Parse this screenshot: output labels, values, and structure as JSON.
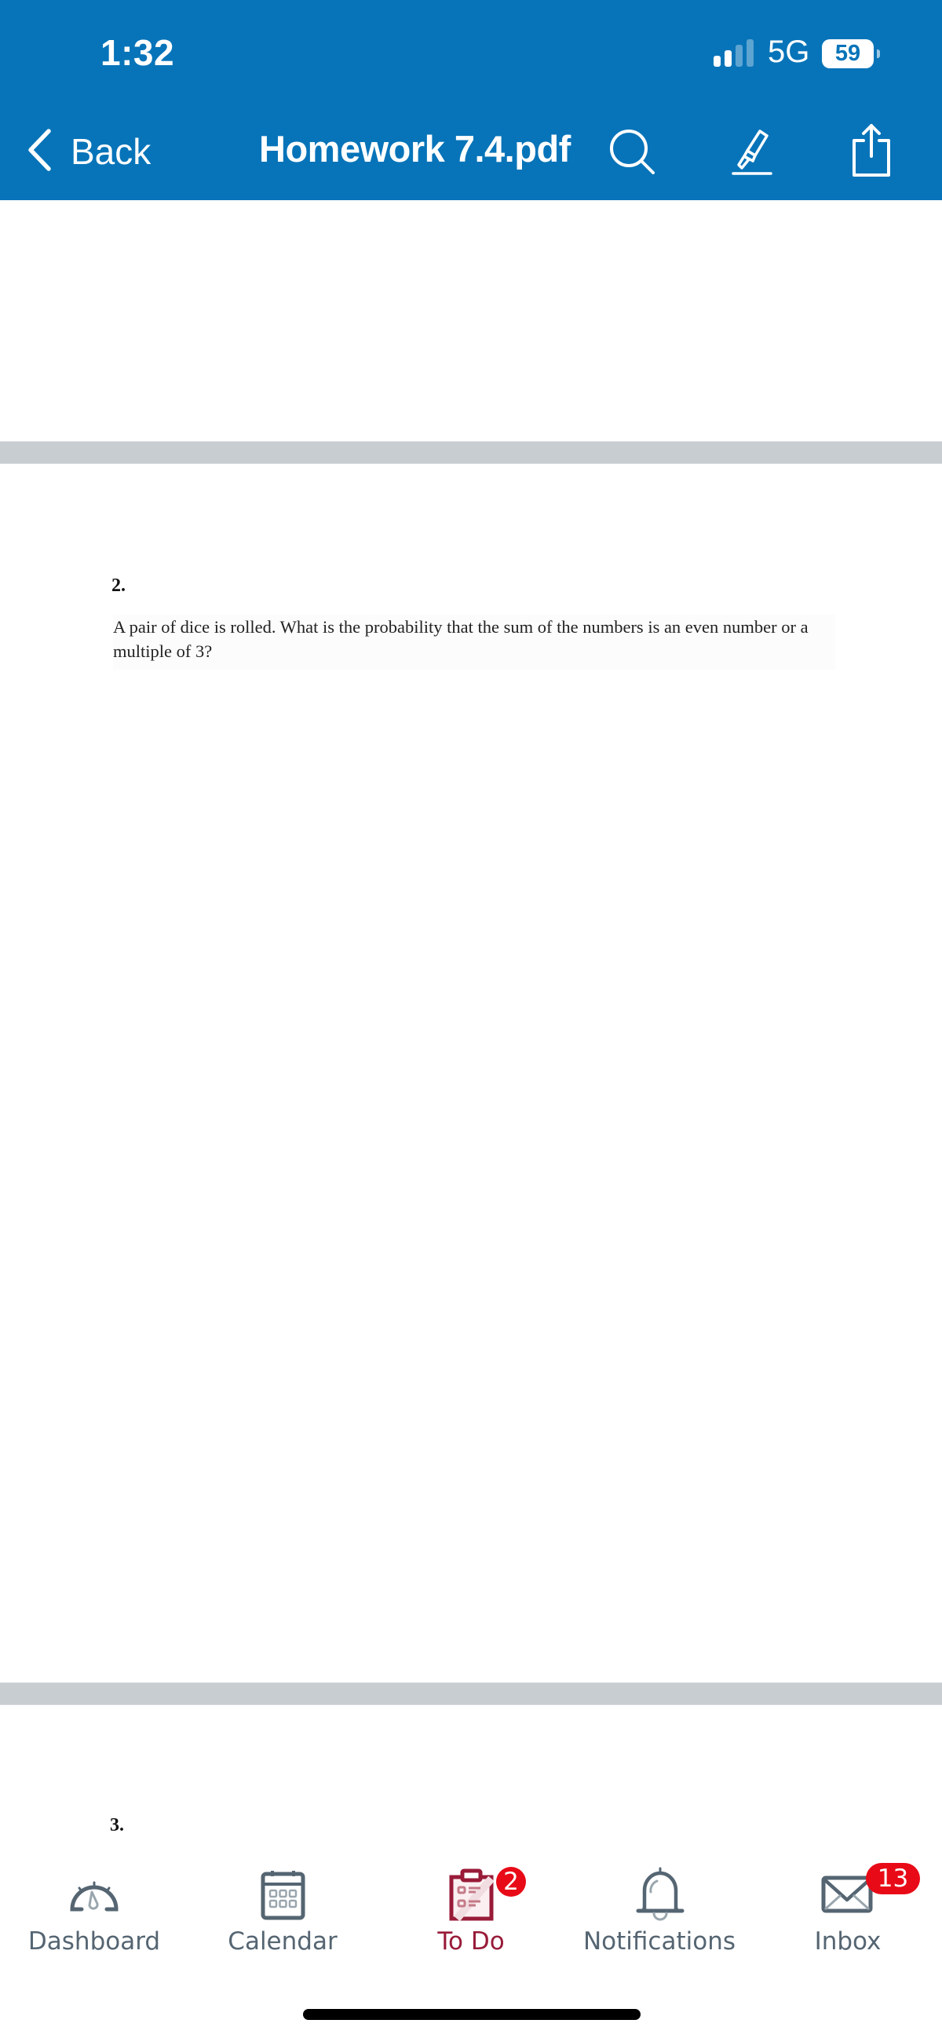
{
  "status_bar": {
    "time": "1:32",
    "network": "5G",
    "battery": "59",
    "signal_bars_active": 2,
    "signal_bars_total": 4
  },
  "nav": {
    "back_label": "Back",
    "title": "Homework 7.4.pdf",
    "actions": [
      "search-icon",
      "highlighter-icon",
      "share-icon"
    ]
  },
  "document": {
    "questions": [
      {
        "number": "2.",
        "text": "A pair of dice is rolled. What is the probability that the sum of the numbers is an even number or a multiple of 3?"
      },
      {
        "number": "3.",
        "text": ""
      }
    ]
  },
  "tabbar": {
    "items": [
      {
        "label": "Dashboard",
        "icon": "dashboard-gauge-icon",
        "active": false
      },
      {
        "label": "Calendar",
        "icon": "calendar-icon",
        "active": false
      },
      {
        "label": "To Do",
        "icon": "todo-clipboard-icon",
        "active": true,
        "badge": "2"
      },
      {
        "label": "Notifications",
        "icon": "bell-icon",
        "active": false
      },
      {
        "label": "Inbox",
        "icon": "envelope-icon",
        "active": false,
        "badge": "13"
      }
    ]
  },
  "colors": {
    "header_bg": "#0774b9",
    "active_tab": "#981b38",
    "inactive_tab": "#556572",
    "badge": "#e80a17",
    "page_separator": "#c8cdd1"
  }
}
